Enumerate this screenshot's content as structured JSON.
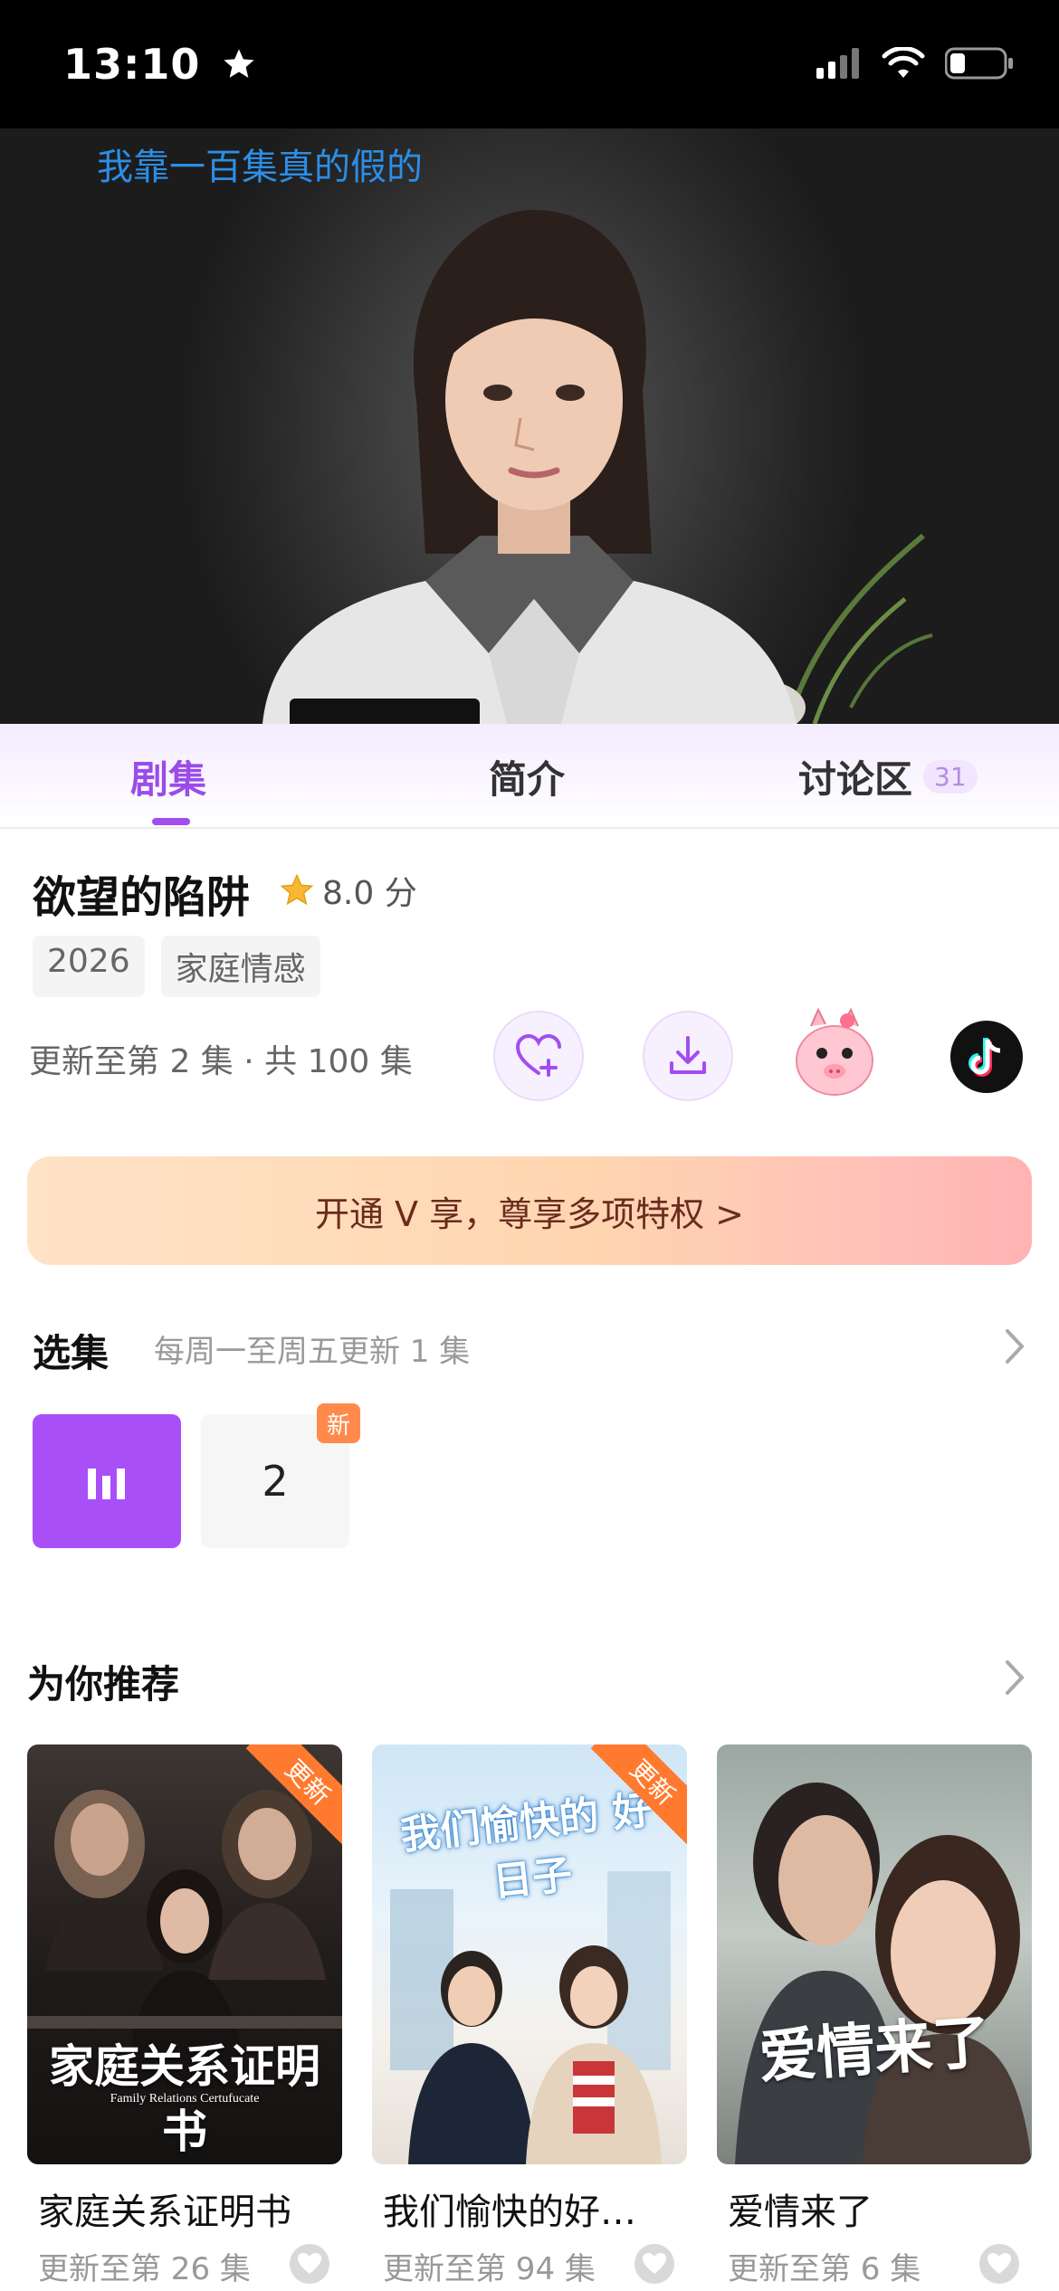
{
  "status_bar": {
    "time": "13:10"
  },
  "video": {
    "subtitle": "我靠一百集真的假的"
  },
  "tabs": [
    {
      "label": "剧集",
      "active": true
    },
    {
      "label": "简介",
      "active": false
    },
    {
      "label": "讨论区",
      "count": "31",
      "active": false
    }
  ],
  "show": {
    "title": "欲望的陷阱",
    "rating": "8.0 分",
    "tags": [
      "2026",
      "家庭情感"
    ],
    "update_info": "更新至第 2 集 · 共 100 集"
  },
  "actions": [
    {
      "icon": "heart-plus-icon"
    },
    {
      "icon": "download-icon"
    },
    {
      "icon": "mascot-icon"
    },
    {
      "icon": "tiktok-icon"
    }
  ],
  "vip_banner": {
    "text": "开通 V 享，尊享多项特权 >"
  },
  "episodes": {
    "title": "选集",
    "subtitle": "每周一至周五更新 1 集",
    "items": [
      {
        "label": "",
        "state": "playing"
      },
      {
        "label": "2",
        "badge": "新"
      }
    ]
  },
  "recommend": {
    "title": "为你推荐",
    "items": [
      {
        "title": "家庭关系证明书",
        "poster_text": "家庭关系证明书",
        "poster_sub": "Family Relations Certufucate",
        "ribbon": "更新",
        "update": "更新至第 26 集"
      },
      {
        "title": "我们愉快的好…",
        "poster_text": "我们愉快的 好日子",
        "ribbon": "更新",
        "update": "更新至第 94 集"
      },
      {
        "title": "爱情来了",
        "poster_text": "爱情来了",
        "update": "更新至第 6 集"
      }
    ]
  },
  "colors": {
    "accent": "#a94ff8",
    "ribbon": "#ff7a2f"
  }
}
